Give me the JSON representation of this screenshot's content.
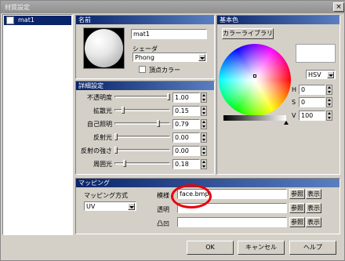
{
  "window": {
    "title": "材質設定",
    "close": "×"
  },
  "materials": [
    {
      "name": "mat1"
    }
  ],
  "name_group": {
    "title": "名前",
    "name_value": "mat1",
    "shader_label": "シェーダ",
    "shader_value": "Phong",
    "vertex_color_label": "頂点カラー"
  },
  "basic_color": {
    "title": "基本色",
    "library_button": "カラーライブラリ",
    "mode": "HSV",
    "h_label": "H",
    "h_value": "0",
    "s_label": "S",
    "s_value": "0",
    "v_label": "V",
    "v_value": "100",
    "value_level": 1.0,
    "swatch_color": "#ffffff"
  },
  "detail": {
    "title": "詳細設定",
    "rows": [
      {
        "label": "不透明度",
        "value": "1.00",
        "level": 1.0
      },
      {
        "label": "拡散光",
        "value": "0.15",
        "level": 0.15
      },
      {
        "label": "自己照明",
        "value": "0.79",
        "level": 0.79
      },
      {
        "label": "反射光",
        "value": "0.00",
        "level": 0.0
      },
      {
        "label": "反射の強さ",
        "value": "0.00",
        "level": 0.0
      },
      {
        "label": "周囲光",
        "value": "0.18",
        "level": 0.18
      }
    ]
  },
  "mapping": {
    "title": "マッピング",
    "method_label": "マッピング方式",
    "method_value": "UV",
    "rows": [
      {
        "label": "模様",
        "value": "face.bmp",
        "browse": "参照",
        "show": "表示"
      },
      {
        "label": "透明",
        "value": "",
        "browse": "参照",
        "show": "表示"
      },
      {
        "label": "凸凹",
        "value": "",
        "browse": "参照",
        "show": "表示"
      }
    ],
    "highlight_color": "#e8000a"
  },
  "footer": {
    "ok": "OK",
    "cancel": "キャンセル",
    "help": "ヘルプ"
  }
}
